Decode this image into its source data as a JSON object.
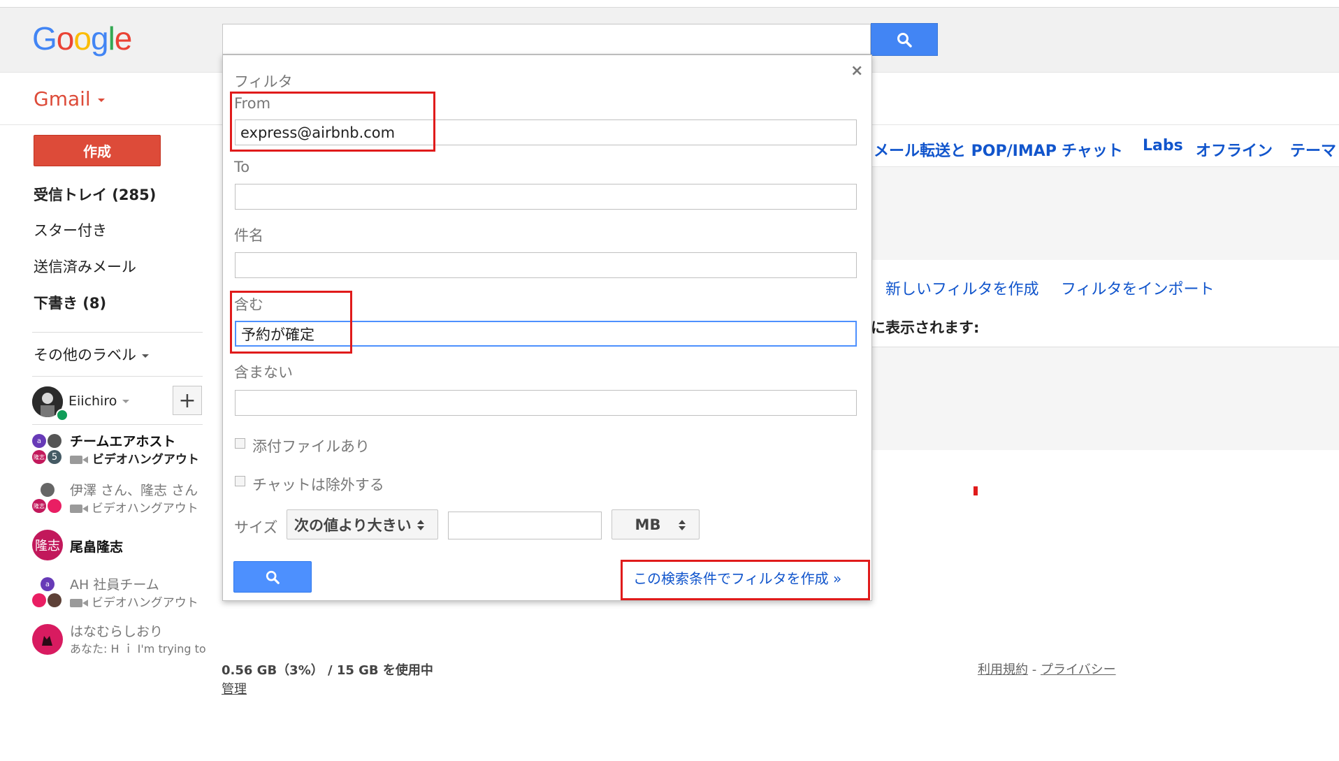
{
  "header": {
    "logo": "Google",
    "logo_colors": [
      "#4285f4",
      "#ea4335",
      "#fbbc05",
      "#4285f4",
      "#34a853",
      "#ea4335"
    ],
    "search_value": "",
    "search_icon": "search-icon"
  },
  "app": {
    "title": "Gmail",
    "accent": "#dd4b39"
  },
  "sidebar": {
    "compose_label": "作成",
    "items": [
      {
        "label": "受信トレイ (285)"
      },
      {
        "label": "スター付き"
      },
      {
        "label": "送信済みメール"
      },
      {
        "label": "下書き (8)"
      }
    ],
    "more_labels": "その他のラベル"
  },
  "chat": {
    "me": {
      "name": "Eiichiro",
      "status_color": "#0f9d58"
    },
    "add_label": "+",
    "contacts": [
      {
        "name": "チームエアホスト",
        "sub": "ビデオハングアウト",
        "avatar_letters": [
          "a",
          "隆志",
          "5"
        ]
      },
      {
        "name": "伊澤 さん、隆志 さん",
        "sub": "ビデオハングアウト",
        "avatar_letters": [
          "隆志"
        ]
      },
      {
        "name": "尾畠隆志",
        "sub": "",
        "avatar_letters": [
          "隆志"
        ]
      },
      {
        "name": "AH 社員チーム",
        "sub": "ビデオハングアウト",
        "avatar_letters": [
          "a"
        ]
      },
      {
        "name": "はなむらしおり",
        "sub": "あなた: H ｉ I'm trying to",
        "avatar_letters": []
      }
    ]
  },
  "settings": {
    "tabs": [
      "メール転送と POP/IMAP",
      "チャット",
      "Labs",
      "オフライン",
      "テーマ"
    ],
    "new_filter": "新しいフィルタを作成",
    "import_filter": "フィルタをインポート",
    "shown_text": "に表示されます:"
  },
  "filter": {
    "title": "フィルタ",
    "close": "×",
    "from_label": "From",
    "from_value": "express@airbnb.com",
    "to_label": "To",
    "to_value": "",
    "subject_label": "件名",
    "subject_value": "",
    "contains_label": "含む",
    "contains_value": "予約が確定",
    "excludes_label": "含まない",
    "excludes_value": "",
    "attachment_label": "添付ファイルあり",
    "no_chats_label": "チャットは除外する",
    "size_label": "サイズ",
    "size_operator": "次の値より大きい",
    "size_value": "",
    "size_unit": "MB",
    "create_link": "この検索条件でフィルタを作成 »",
    "highlight_color": "#e01b1b"
  },
  "footer": {
    "storage": "0.56 GB（3%） / 15 GB を使用中",
    "manage": "管理",
    "terms": "利用規約",
    "separator": " - ",
    "privacy": "プライバシー"
  }
}
